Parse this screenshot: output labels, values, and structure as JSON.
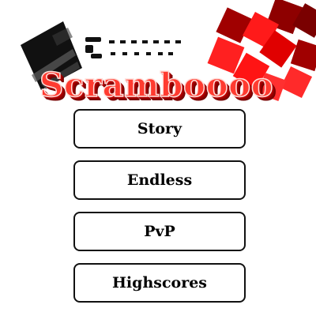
{
  "game": {
    "title": "Scramboooo"
  },
  "menu": {
    "items": [
      {
        "label": "Story"
      },
      {
        "label": "Endless"
      },
      {
        "label": "PvP"
      },
      {
        "label": "Highscores"
      }
    ]
  },
  "colors": {
    "title_fill": "#ff3b30",
    "title_shadow": "#8b0000",
    "tile_bright": "#ff1a1a",
    "tile_dark": "#a00000",
    "tile_black": "#111111",
    "button_border": "#111111",
    "background": "#ffffff"
  },
  "icons": [
    "dark-block-icon",
    "dotted-trail-icon",
    "red-tiles-cluster"
  ]
}
